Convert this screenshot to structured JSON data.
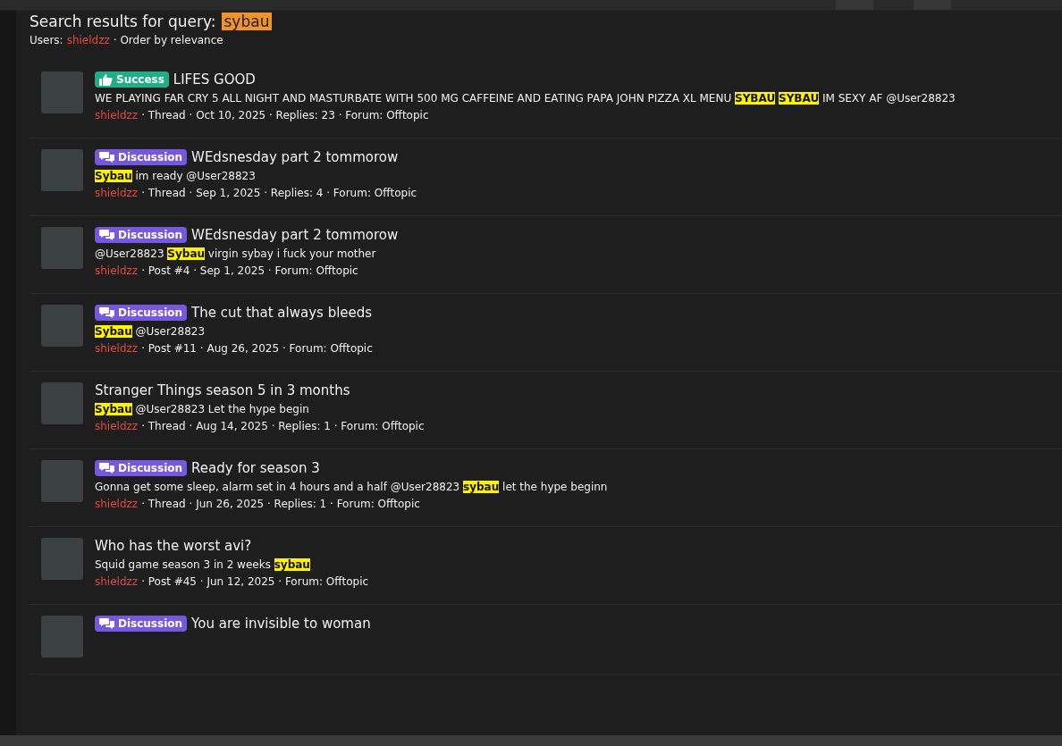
{
  "heading": {
    "text": "Search results for query:",
    "query": "sybau"
  },
  "filter": {
    "users_label": "Users:",
    "user": "shieldzz",
    "order": "· Order by relevance"
  },
  "results": [
    {
      "badge": {
        "kind": "success",
        "label": "Success"
      },
      "title": "LIFES GOOD",
      "excerpt": "WE PLAYING FAR CRY 5 ALL NIGHT AND MASTURBATE WITH 500 MG CAFFEINE AND EATING PAPA JOHN PIZZA XL MENU **SYBAU** **SYBAU** IM SEXY AF @User28823",
      "author": "shieldzz",
      "meta": "· Thread · Oct 10, 2025 · Replies: 23 · Forum: Offtopic"
    },
    {
      "badge": {
        "kind": "discussion",
        "label": "Discussion"
      },
      "title": "WEdsnesday part 2 tommorow",
      "excerpt": "**Sybau** im ready @User28823",
      "author": "shieldzz",
      "meta": "· Thread · Sep 1, 2025 · Replies: 4 · Forum: Offtopic"
    },
    {
      "badge": {
        "kind": "discussion",
        "label": "Discussion"
      },
      "title": "WEdsnesday part 2 tommorow",
      "excerpt": "@User28823 **Sybau** virgin sybay i fuck your mother",
      "author": "shieldzz",
      "meta": "· Post #4 · Sep 1, 2025 · Forum: Offtopic"
    },
    {
      "badge": {
        "kind": "discussion",
        "label": "Discussion"
      },
      "title": "The cut that always bleeds",
      "excerpt": "**Sybau** @User28823",
      "author": "shieldzz",
      "meta": "· Post #11 · Aug 26, 2025 · Forum: Offtopic"
    },
    {
      "title": "Stranger Things season 5 in 3 months",
      "excerpt": "**Sybau** @User28823 Let the hype begin",
      "author": "shieldzz",
      "meta": "· Thread · Aug 14, 2025 · Replies: 1 · Forum: Offtopic"
    },
    {
      "badge": {
        "kind": "discussion",
        "label": "Discussion"
      },
      "title": "Ready for season 3",
      "excerpt": "Gonna get some sleep, alarm set in 4 hours and a half @User28823 **sybau** let the hype beginn",
      "author": "shieldzz",
      "meta": "· Thread · Jun 26, 2025 · Replies: 1 · Forum: Offtopic"
    },
    {
      "title": "Who has the worst avi?",
      "excerpt": "Squid game season 3 in 2 weeks **sybau**",
      "author": "shieldzz",
      "meta": "· Post #45 · Jun 12, 2025 · Forum: Offtopic"
    },
    {
      "badge": {
        "kind": "discussion",
        "label": "Discussion"
      },
      "title": "You are invisible to woman"
    }
  ]
}
